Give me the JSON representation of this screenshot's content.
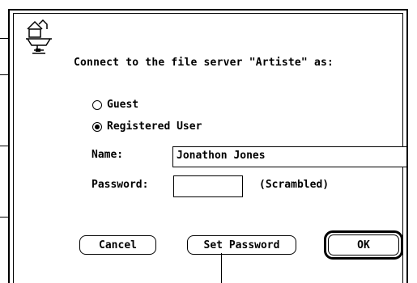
{
  "dialog": {
    "icon": "file-server-icon",
    "prompt": "Connect to the file server \"Artiste\" as:"
  },
  "login_mode": {
    "options": [
      {
        "label": "Guest",
        "checked": false
      },
      {
        "label": "Registered User",
        "checked": true
      }
    ]
  },
  "fields": {
    "name_label": "Name:",
    "name_value": "Jonathon Jones",
    "password_label": "Password:",
    "password_value": "",
    "password_note": "(Scrambled)"
  },
  "buttons": {
    "cancel": "Cancel",
    "set_password": "Set Password",
    "ok": "OK"
  }
}
